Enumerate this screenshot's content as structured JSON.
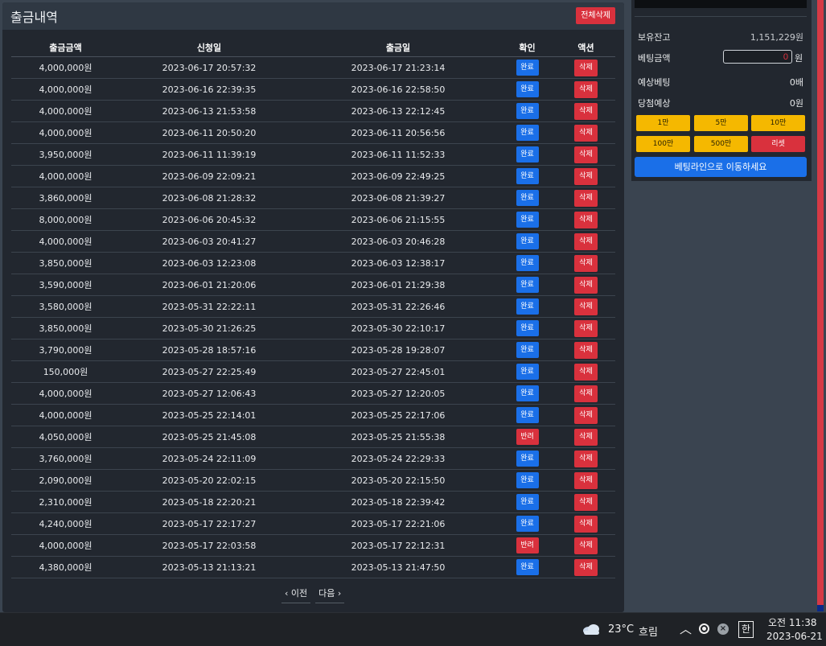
{
  "panel": {
    "title": "출금내역",
    "delete_all_label": "전체삭제",
    "columns": [
      "출금금액",
      "신청일",
      "출금일",
      "확인",
      "액션"
    ],
    "rows": [
      {
        "amount": "4,000,000원",
        "requested": "2023-06-17 20:57:32",
        "paid": "2023-06-17 21:23:14",
        "status": "완료",
        "status_type": "done",
        "action": "삭제"
      },
      {
        "amount": "4,000,000원",
        "requested": "2023-06-16 22:39:35",
        "paid": "2023-06-16 22:58:50",
        "status": "완료",
        "status_type": "done",
        "action": "삭제"
      },
      {
        "amount": "4,000,000원",
        "requested": "2023-06-13 21:53:58",
        "paid": "2023-06-13 22:12:45",
        "status": "완료",
        "status_type": "done",
        "action": "삭제"
      },
      {
        "amount": "4,000,000원",
        "requested": "2023-06-11 20:50:20",
        "paid": "2023-06-11 20:56:56",
        "status": "완료",
        "status_type": "done",
        "action": "삭제"
      },
      {
        "amount": "3,950,000원",
        "requested": "2023-06-11 11:39:19",
        "paid": "2023-06-11 11:52:33",
        "status": "완료",
        "status_type": "done",
        "action": "삭제"
      },
      {
        "amount": "4,000,000원",
        "requested": "2023-06-09 22:09:21",
        "paid": "2023-06-09 22:49:25",
        "status": "완료",
        "status_type": "done",
        "action": "삭제"
      },
      {
        "amount": "3,860,000원",
        "requested": "2023-06-08 21:28:32",
        "paid": "2023-06-08 21:39:27",
        "status": "완료",
        "status_type": "done",
        "action": "삭제"
      },
      {
        "amount": "8,000,000원",
        "requested": "2023-06-06 20:45:32",
        "paid": "2023-06-06 21:15:55",
        "status": "완료",
        "status_type": "done",
        "action": "삭제"
      },
      {
        "amount": "4,000,000원",
        "requested": "2023-06-03 20:41:27",
        "paid": "2023-06-03 20:46:28",
        "status": "완료",
        "status_type": "done",
        "action": "삭제"
      },
      {
        "amount": "3,850,000원",
        "requested": "2023-06-03 12:23:08",
        "paid": "2023-06-03 12:38:17",
        "status": "완료",
        "status_type": "done",
        "action": "삭제"
      },
      {
        "amount": "3,590,000원",
        "requested": "2023-06-01 21:20:06",
        "paid": "2023-06-01 21:29:38",
        "status": "완료",
        "status_type": "done",
        "action": "삭제"
      },
      {
        "amount": "3,580,000원",
        "requested": "2023-05-31 22:22:11",
        "paid": "2023-05-31 22:26:46",
        "status": "완료",
        "status_type": "done",
        "action": "삭제"
      },
      {
        "amount": "3,850,000원",
        "requested": "2023-05-30 21:26:25",
        "paid": "2023-05-30 22:10:17",
        "status": "완료",
        "status_type": "done",
        "action": "삭제"
      },
      {
        "amount": "3,790,000원",
        "requested": "2023-05-28 18:57:16",
        "paid": "2023-05-28 19:28:07",
        "status": "완료",
        "status_type": "done",
        "action": "삭제"
      },
      {
        "amount": "150,000원",
        "requested": "2023-05-27 22:25:49",
        "paid": "2023-05-27 22:45:01",
        "status": "완료",
        "status_type": "done",
        "action": "삭제"
      },
      {
        "amount": "4,000,000원",
        "requested": "2023-05-27 12:06:43",
        "paid": "2023-05-27 12:20:05",
        "status": "완료",
        "status_type": "done",
        "action": "삭제"
      },
      {
        "amount": "4,000,000원",
        "requested": "2023-05-25 22:14:01",
        "paid": "2023-05-25 22:17:06",
        "status": "완료",
        "status_type": "done",
        "action": "삭제"
      },
      {
        "amount": "4,050,000원",
        "requested": "2023-05-25 21:45:08",
        "paid": "2023-05-25 21:55:38",
        "status": "반려",
        "status_type": "rej",
        "action": "삭제"
      },
      {
        "amount": "3,760,000원",
        "requested": "2023-05-24 22:11:09",
        "paid": "2023-05-24 22:29:33",
        "status": "완료",
        "status_type": "done",
        "action": "삭제"
      },
      {
        "amount": "2,090,000원",
        "requested": "2023-05-20 22:02:15",
        "paid": "2023-05-20 22:15:50",
        "status": "완료",
        "status_type": "done",
        "action": "삭제"
      },
      {
        "amount": "2,310,000원",
        "requested": "2023-05-18 22:20:21",
        "paid": "2023-05-18 22:39:42",
        "status": "완료",
        "status_type": "done",
        "action": "삭제"
      },
      {
        "amount": "4,240,000원",
        "requested": "2023-05-17 22:17:27",
        "paid": "2023-05-17 22:21:06",
        "status": "완료",
        "status_type": "done",
        "action": "삭제"
      },
      {
        "amount": "4,000,000원",
        "requested": "2023-05-17 22:03:58",
        "paid": "2023-05-17 22:12:31",
        "status": "반려",
        "status_type": "rej",
        "action": "삭제"
      },
      {
        "amount": "4,380,000원",
        "requested": "2023-05-13 21:13:21",
        "paid": "2023-05-13 21:47:50",
        "status": "완료",
        "status_type": "done",
        "action": "삭제"
      }
    ],
    "pager": {
      "prev": "‹ 이전",
      "next": "다음 ›"
    }
  },
  "betslip": {
    "balance_label": "보유잔고",
    "balance_value": "1,151,229원",
    "bet_label": "베팅금액",
    "bet_value": "0",
    "bet_unit": "원",
    "odds_label": "예상베팅",
    "odds_value": "0배",
    "win_label": "당첨예상",
    "win_value": "0원",
    "amount_buttons": [
      "1만",
      "5만",
      "10만",
      "100만",
      "500만"
    ],
    "reset_label": "리셋",
    "go_label": "베팅라인으로 이동하세요"
  },
  "taskbar": {
    "temp": "23°C",
    "weather": "흐림",
    "ime": "한",
    "time": "오전 11:38",
    "date": "2023-06-21"
  },
  "icons": {
    "weather": "cloud-icon",
    "chevron": "chevron-up-icon",
    "record": "record-icon",
    "close": "close-icon"
  }
}
